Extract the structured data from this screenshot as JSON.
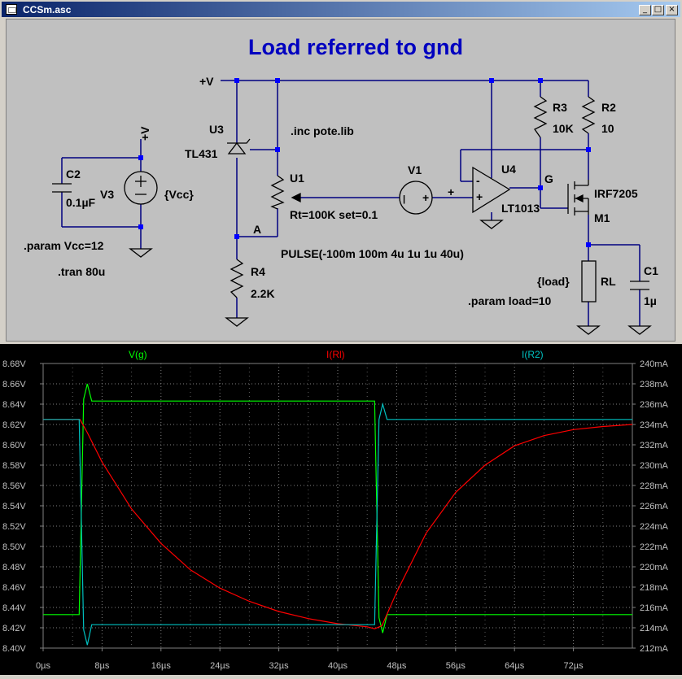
{
  "window": {
    "title": "CCSm.asc",
    "buttons": {
      "minimize": "_",
      "maximize": "□",
      "close": "×"
    }
  },
  "schematic": {
    "heading": "Load referred to gnd",
    "labels": {
      "vplus_top": "+V",
      "vplus_left": "+V",
      "u3": "U3",
      "tl431": "TL431",
      "inc": ".inc pote.lib",
      "u1": "U1",
      "u1_params": "Rt=100K set=0.1",
      "node_a": "A",
      "r4": "R4",
      "r4_val": "2.2K",
      "v1": "V1",
      "pulse": "PULSE(-100m 100m 4u 1u 1u 40u)",
      "u4": "U4",
      "lt1013": "LT1013",
      "r3": "R3",
      "r3_val": "10K",
      "r2": "R2",
      "r2_val": "10",
      "g": "G",
      "irf": "IRF7205",
      "m1": "M1",
      "load": "{load}",
      "rl": "RL",
      "param_load": ".param load=10",
      "c1": "C1",
      "c1_val": "1µ",
      "c2": "C2",
      "c2_val": "0.1µF",
      "v3": "V3",
      "vcc": "{Vcc}",
      "param_vcc": ".param Vcc=12",
      "tran": ".tran 80u",
      "plus": "+",
      "minus": "-",
      "v1_minus": "|",
      "v1_plus": "+"
    }
  },
  "plot": {
    "trace_labels": [
      {
        "name": "V(g)",
        "color": "#00ff00"
      },
      {
        "name": "I(Rl)",
        "color": "#ff0000"
      },
      {
        "name": "I(R2)",
        "color": "#00c0c0"
      }
    ],
    "left_ticks": [
      "8.68V",
      "8.66V",
      "8.64V",
      "8.62V",
      "8.60V",
      "8.58V",
      "8.56V",
      "8.54V",
      "8.52V",
      "8.50V",
      "8.48V",
      "8.46V",
      "8.44V",
      "8.42V",
      "8.40V"
    ],
    "right_ticks": [
      "240mA",
      "238mA",
      "236mA",
      "234mA",
      "232mA",
      "230mA",
      "228mA",
      "226mA",
      "224mA",
      "222mA",
      "220mA",
      "218mA",
      "216mA",
      "214mA",
      "212mA"
    ],
    "x_ticks": [
      "0µs",
      "8µs",
      "16µs",
      "24µs",
      "32µs",
      "40µs",
      "48µs",
      "56µs",
      "64µs",
      "72µs"
    ]
  },
  "chart_data": {
    "type": "line",
    "title": "",
    "xlabel": "",
    "ylabel": "",
    "xlim": [
      0,
      80
    ],
    "ylim_left": [
      8.4,
      8.68
    ],
    "ylim_right": [
      212,
      240
    ],
    "grid": true,
    "legend": "top",
    "series": [
      {
        "name": "V(g)",
        "axis": "left",
        "color": "#00ff00",
        "x": [
          0,
          4.9,
          5.5,
          6.0,
          6.6,
          7.2,
          45.0,
          45.6,
          46.1,
          46.7,
          47.3,
          80
        ],
        "y": [
          8.433,
          8.433,
          8.645,
          8.66,
          8.643,
          8.643,
          8.643,
          8.43,
          8.415,
          8.433,
          8.433,
          8.433
        ]
      },
      {
        "name": "I(Rl)",
        "axis": "right",
        "color": "#ff0000",
        "x": [
          0,
          5,
          6,
          8,
          12,
          16,
          20,
          24,
          28,
          32,
          36,
          40,
          44,
          45,
          46,
          48,
          52,
          56,
          60,
          64,
          68,
          72,
          76,
          80
        ],
        "y": [
          234.5,
          234.5,
          233.2,
          230.3,
          225.7,
          222.3,
          219.7,
          217.9,
          216.6,
          215.6,
          214.9,
          214.4,
          214.1,
          213.9,
          214.2,
          217.5,
          223.3,
          227.3,
          230.0,
          231.9,
          232.9,
          233.5,
          233.8,
          234.0
        ]
      },
      {
        "name": "I(R2)",
        "axis": "right",
        "color": "#00c0c0",
        "x": [
          0,
          4.9,
          5.5,
          6.0,
          6.6,
          7.2,
          45.0,
          45.6,
          46.1,
          46.7,
          47.3,
          80
        ],
        "y": [
          234.5,
          234.5,
          213.8,
          212.3,
          214.3,
          214.3,
          214.3,
          234.5,
          236.0,
          234.5,
          234.5,
          234.5
        ]
      }
    ]
  }
}
